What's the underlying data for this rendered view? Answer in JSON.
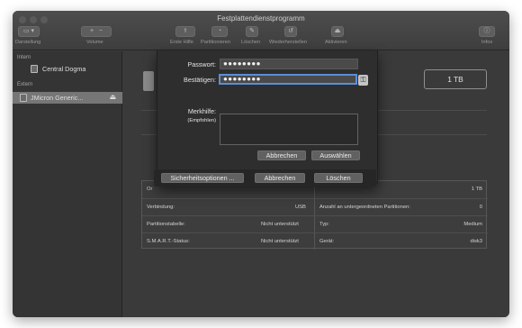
{
  "app": {
    "title": "Festplattendienstprogramm"
  },
  "toolbar": {
    "darstellung": "Darstellung",
    "volume": "Volume",
    "erste_hilfe": "Erste Hilfe",
    "partitionieren": "Partitionieren",
    "loeschen": "Löschen",
    "wiederherstellen": "Wiederherstellen",
    "aktivieren": "Aktivieren",
    "infos": "Infos",
    "volume_plus": "+",
    "volume_minus": "−"
  },
  "sidebar": {
    "intern_header": "Intern",
    "extern_header": "Extern",
    "items": [
      {
        "label": "Central Dogma"
      },
      {
        "label": "JMicron Generic...",
        "selected": true
      }
    ]
  },
  "main": {
    "capacity": "1 TB",
    "info_rows": [
      {
        "left_label": "Or",
        "left_value": "",
        "right_label": "",
        "right_value": "1 TB"
      },
      {
        "left_label": "Verbindung:",
        "left_value": "USB",
        "right_label": "Anzahl an untergeordneten Partitionen:",
        "right_value": "0"
      },
      {
        "left_label": "Partitionstabelle:",
        "left_value": "Nicht unterstützt",
        "right_label": "Typ:",
        "right_value": "Medium"
      },
      {
        "left_label": "S.M.A.R.T.-Status:",
        "left_value": "Nicht unterstützt",
        "right_label": "Gerät:",
        "right_value": "disk3"
      }
    ]
  },
  "dialog": {
    "password_label": "Passwort:",
    "password_value": "●●●●●●●●",
    "confirm_label": "Bestätigen:",
    "confirm_value": "●●●●●●●●",
    "hint_label": "Merkhilfe:",
    "hint_sub": "(Empfohlen)",
    "hint_value": "",
    "cancel_inner": "Abbrechen",
    "choose": "Auswählen",
    "security_options": "Sicherheitsoptionen ...",
    "cancel_outer": "Abbrechen",
    "erase": "Löschen"
  }
}
